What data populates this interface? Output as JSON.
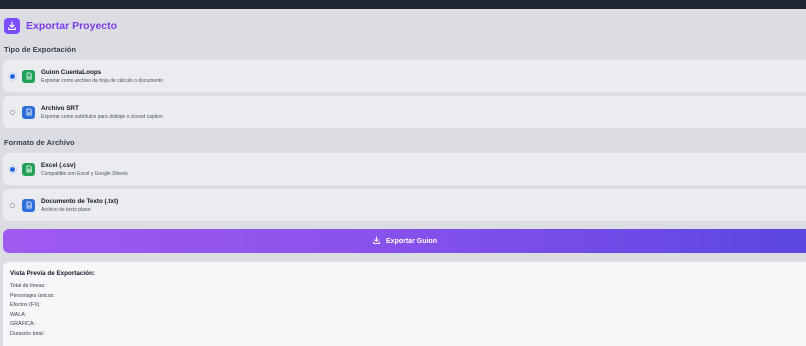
{
  "header": {
    "title": "Exportar Proyecto",
    "icon": "download-icon",
    "accent": "#7c3aed"
  },
  "export_type": {
    "section_title": "Tipo de Exportación",
    "options": [
      {
        "title": "Guion CuentaLoops",
        "description": "Exportar como archivo de hoja de cálculo o documento",
        "selected": true,
        "icon": "document-icon",
        "icon_color": "#22a05a"
      },
      {
        "title": "Archivo SRT",
        "description": "Exportar como subtítulos para doblaje o closed caption",
        "selected": false,
        "icon": "document-icon",
        "icon_color": "#2f6fd9"
      }
    ]
  },
  "file_format": {
    "section_title": "Formato de Archivo",
    "options": [
      {
        "title": "Excel (.csv)",
        "description": "Compatible con Excel y Google Sheets",
        "selected": true,
        "icon": "spreadsheet-icon",
        "icon_color": "#22a05a"
      },
      {
        "title": "Documento de Texto (.txt)",
        "description": "Archivo de texto plano",
        "selected": false,
        "icon": "document-icon",
        "icon_color": "#2f6fd9"
      }
    ]
  },
  "export_button": {
    "label": "Exportar Guion",
    "icon": "download-icon"
  },
  "preview": {
    "title": "Vista Previa de Exportación:",
    "rows": [
      {
        "label": "Total de líneas:"
      },
      {
        "label": "Personajes únicos:"
      },
      {
        "label": "Efectos (FX):"
      },
      {
        "label": "WALA:"
      },
      {
        "label": "GRÁFICA:"
      },
      {
        "label": "Duración total:"
      }
    ]
  }
}
